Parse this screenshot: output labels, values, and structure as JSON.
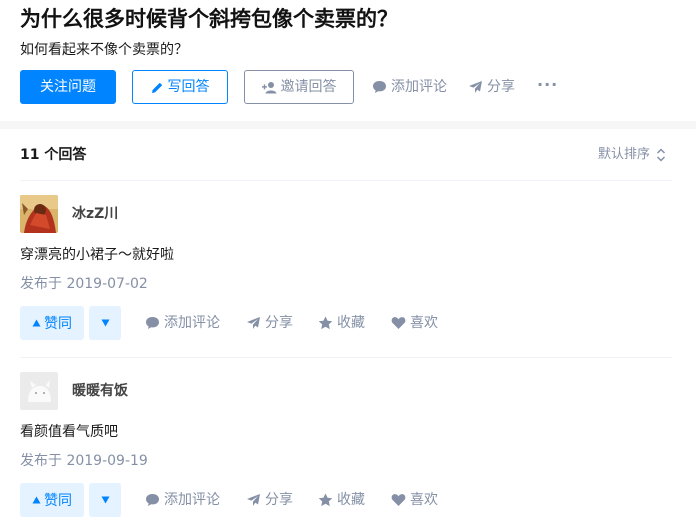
{
  "question": {
    "title": "为什么很多时候背个斜挎包像个卖票的？",
    "subtitle": "如何看起来不像个卖票的？"
  },
  "actions": {
    "follow": "关注问题",
    "write_answer": "写回答",
    "invite": "邀请回答",
    "comment": "添加评论",
    "share": "分享",
    "more": "···"
  },
  "answers_header": {
    "count": "11 个回答",
    "sort": "默认排序"
  },
  "answers": [
    {
      "author": "冰zZ川",
      "content": "穿漂亮的小裙子～就好啦",
      "date": "发布于 2019-07-02",
      "upvote": "赞同",
      "comment": "添加评论",
      "share": "分享",
      "favorite": "收藏",
      "like": "喜欢"
    },
    {
      "author": "暖暖有饭",
      "content": "看颜值看气质吧",
      "date": "发布于 2019-09-19",
      "upvote": "赞同",
      "comment": "添加评论",
      "share": "分享",
      "favorite": "收藏",
      "like": "喜欢"
    }
  ],
  "colors": {
    "primary": "#0084ff",
    "muted": "#8590a6",
    "vote_bg": "#e5f2ff"
  }
}
